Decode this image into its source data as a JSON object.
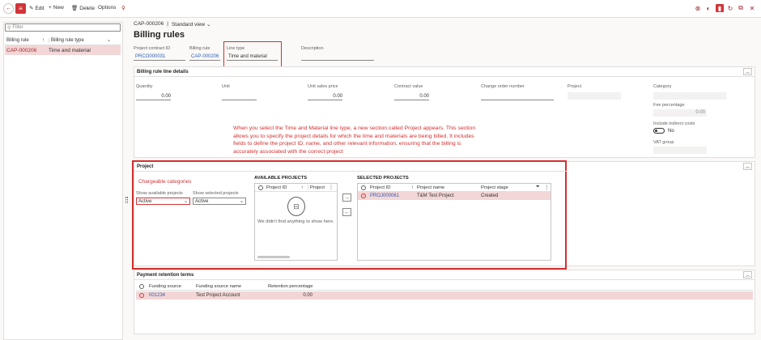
{
  "toolbar": {
    "edit_label": "Edit",
    "new_label": "New",
    "delete_label": "Delete",
    "options_label": "Options"
  },
  "left_pane": {
    "filter_placeholder": "Filter",
    "columns": [
      "Billing rule",
      "Billing rule type"
    ],
    "rows": [
      {
        "rule": "CAP-000206",
        "type": "Time and material"
      }
    ]
  },
  "header": {
    "breadcrumb_id": "CAP-000206",
    "separator": "|",
    "view": "Standard view",
    "title": "Billing rules"
  },
  "fields": {
    "project_contract_id_label": "Project contract ID",
    "project_contract_id": "PRCO000031",
    "billing_rule_label": "Billing rule",
    "billing_rule": "CAP-000206",
    "line_type_label": "Line type",
    "line_type": "Time and material",
    "description_label": "Description"
  },
  "details": {
    "heading": "Billing rule line details",
    "quantity_label": "Quantity",
    "quantity": "0.00",
    "unit_label": "Unit",
    "unit_sales_price_label": "Unit sales price",
    "unit_sales_price": "0.00",
    "contract_value_label": "Contract value",
    "contract_value": "0.00",
    "change_order_label": "Change order number",
    "project_label": "Project",
    "category_label": "Category",
    "fee_percentage_label": "Fee percentage",
    "fee_percentage": "0.00",
    "include_indirect_label": "Include indirect costs",
    "include_indirect_value": "No",
    "vat_group_label": "VAT group"
  },
  "annotation": [
    "When you select the Time and Material line type, a new section called Project appears. This section",
    "allows you to specify the project details for which the time and materials are being billed. It includes",
    "fields to define the project ID, name, and other relevant information, ensuring that the billing is",
    "accurately associated with the correct project"
  ],
  "project": {
    "heading": "Project",
    "chargeable_link": "Chargeable categories",
    "show_available_label": "Show available projects",
    "show_available_value": "Active",
    "show_selected_label": "Show selected projects",
    "show_selected_value": "Active",
    "available_title": "AVAILABLE PROJECTS",
    "available_columns": [
      "Project ID",
      "Project"
    ],
    "empty_message": "We didn't find anything to show here.",
    "selected_title": "SELECTED PROJECTS",
    "selected_columns": [
      "Project ID",
      "Project name",
      "Project stage"
    ],
    "selected_rows": [
      {
        "id": "PROJ000061",
        "name": "T&M Test Project",
        "stage": "Created"
      }
    ]
  },
  "retention": {
    "heading": "Payment retention terms",
    "columns": [
      "Funding source",
      "Funding source name",
      "Retention percentage"
    ],
    "rows": [
      {
        "source": "001234",
        "name": "Test Project Account",
        "pct": "0.00"
      }
    ]
  },
  "colors": {
    "accent": "#d13438",
    "highlight_border": "#d32f2f",
    "selected_row": "#f3d6d6",
    "link": "#2e5fb0"
  }
}
